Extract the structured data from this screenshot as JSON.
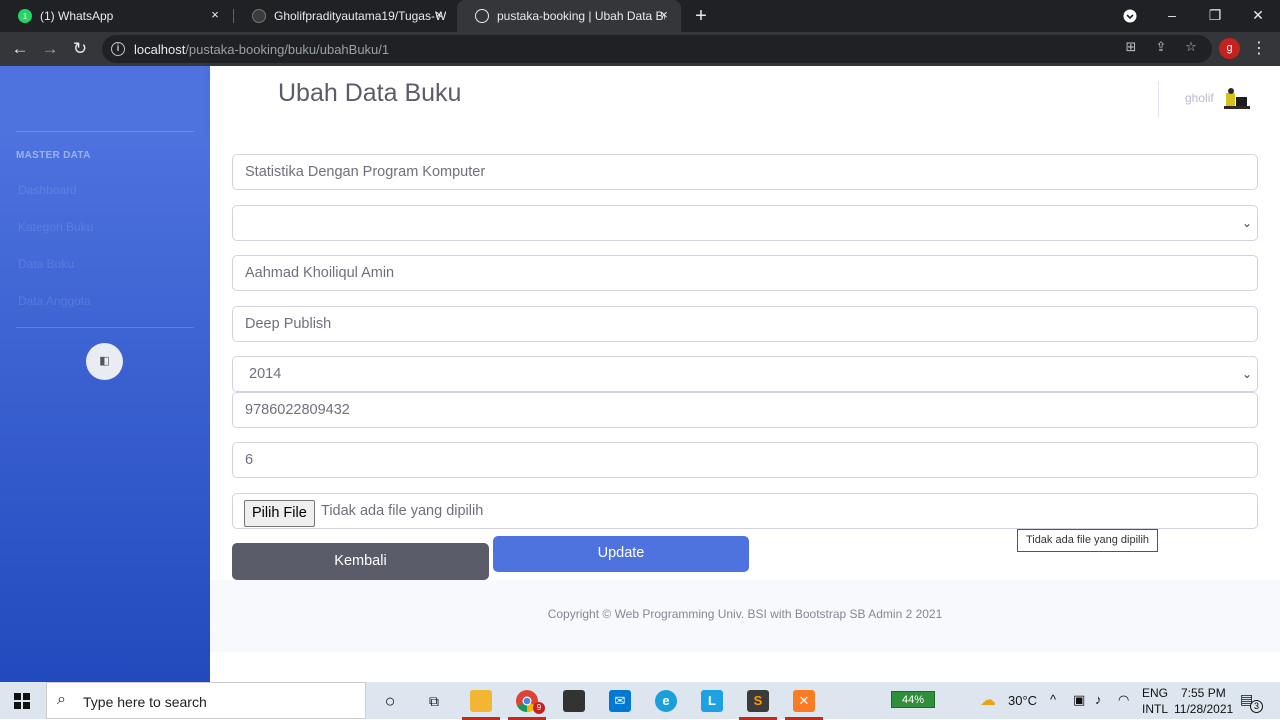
{
  "browser": {
    "tabs": [
      {
        "title": "(1) WhatsApp",
        "close": "×"
      },
      {
        "title": "Gholifpradityautama19/Tugas-W",
        "close": "×"
      },
      {
        "title": "pustaka-booking | Ubah Data Bu",
        "close": "×"
      }
    ],
    "new_tab": "+",
    "url_host": "localhost",
    "url_path": "/pustaka-booking/buku/ubahBuku/1",
    "profile_initial": "g"
  },
  "sidebar": {
    "heading": "MASTER DATA",
    "items": [
      {
        "label": "Dashboard"
      },
      {
        "label": "Kategori Buku"
      },
      {
        "label": "Data Buku"
      },
      {
        "label": "Data Anggota"
      }
    ],
    "toggle_icon": "◧"
  },
  "topbar": {
    "title": "Ubah Data Buku",
    "user_name": "gholif"
  },
  "form": {
    "judul": "Statistika Dengan Program Komputer",
    "kategori": "",
    "pengarang": "Aahmad Khoiliqul Amin",
    "penerbit": "Deep Publish",
    "tahun": "2014",
    "isbn": "9786022809432",
    "stok": "6",
    "file_button": "Pilih File",
    "file_status": "Tidak ada file yang dipilih",
    "back_button": "Kembali",
    "update_button": "Update",
    "tooltip": "Tidak ada file yang dipilih"
  },
  "footer": {
    "copyright": "Copyright © Web Programming Univ. BSI with Bootstrap SB Admin 2 2021"
  },
  "taskbar": {
    "search_placeholder": "Type here to search",
    "battery": "44%",
    "temperature": "30°C",
    "lang_top": "ENG",
    "lang_bottom": "INTL",
    "time": "7:55 PM",
    "date": "11/28/2021",
    "notification_count": "3",
    "chrome_badge": "9"
  },
  "colors": {
    "primary": "#4e73df",
    "secondary": "#5a5c69",
    "sidebar_dark": "#224abe"
  }
}
